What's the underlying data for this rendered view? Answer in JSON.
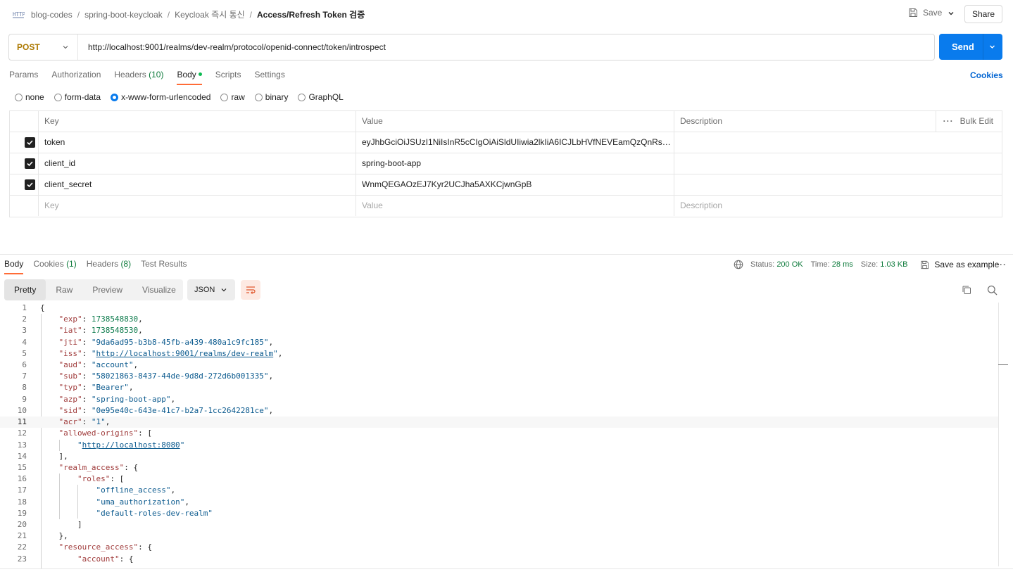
{
  "breadcrumb": {
    "items": [
      "blog-codes",
      "spring-boot-keycloak",
      "Keycloak 즉시 통신"
    ],
    "current": "Access/Refresh Token 검증",
    "separator": "/"
  },
  "toolbar": {
    "save_label": "Save",
    "share_label": "Share"
  },
  "request": {
    "method": "POST",
    "url": "http://localhost:9001/realms/dev-realm/protocol/openid-connect/token/introspect",
    "send_label": "Send"
  },
  "request_tabs": {
    "params": "Params",
    "authorization": "Authorization",
    "headers": "Headers",
    "headers_count": "(10)",
    "body": "Body",
    "scripts": "Scripts",
    "settings": "Settings",
    "cookies": "Cookies"
  },
  "body_types": {
    "none": "none",
    "form_data": "form-data",
    "urlencoded": "x-www-form-urlencoded",
    "raw": "raw",
    "binary": "binary",
    "graphql": "GraphQL",
    "selected": "x-www-form-urlencoded"
  },
  "params_table": {
    "headers": {
      "key": "Key",
      "value": "Value",
      "description": "Description",
      "bulk_edit": "Bulk Edit"
    },
    "rows": [
      {
        "key": "token",
        "value": "eyJhbGciOiJSUzI1NiIsInR5cCIgOiAiSldUIiwia2lkIiA6ICJLbHVfNEVEamQzQnRseUdpa...",
        "checked": true
      },
      {
        "key": "client_id",
        "value": "spring-boot-app",
        "checked": true
      },
      {
        "key": "client_secret",
        "value": "WnmQEGAOzEJ7Kyr2UCJha5AXKCjwnGpB",
        "checked": true
      }
    ],
    "placeholders": {
      "key": "Key",
      "value": "Value",
      "description": "Description"
    }
  },
  "response": {
    "tabs": {
      "body": "Body",
      "cookies": "Cookies",
      "cookies_count": "(1)",
      "headers": "Headers",
      "headers_count": "(8)",
      "test_results": "Test Results"
    },
    "status_label": "Status:",
    "status_value": "200 OK",
    "time_label": "Time:",
    "time_value": "28 ms",
    "size_label": "Size:",
    "size_value": "1.03 KB",
    "save_example": "Save as example",
    "views": {
      "pretty": "Pretty",
      "raw": "Raw",
      "preview": "Preview",
      "visualize": "Visualize"
    },
    "format": "JSON",
    "current_line": 11
  },
  "colors": {
    "accent": "#097bed",
    "tab_underline": "#ff6c37",
    "method": "#ad7a03",
    "status_ok": "#0d7a3b"
  },
  "icons": {
    "app": "http-icon",
    "save": "floppy-icon",
    "globe": "globe-icon",
    "copy": "copy-icon",
    "search": "search-icon",
    "wrap": "wrap-lines-icon"
  }
}
